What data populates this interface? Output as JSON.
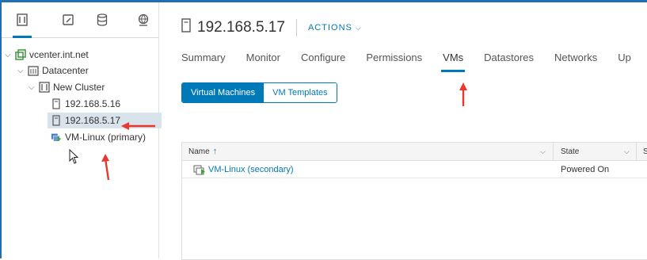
{
  "sidebar": {
    "tabs": [
      {
        "icon": "hosts-clusters-icon",
        "active": true
      },
      {
        "icon": "vms-templates-icon"
      },
      {
        "icon": "storage-icon"
      },
      {
        "icon": "networking-icon"
      }
    ],
    "tree": [
      {
        "label": "vcenter.int.net",
        "icon": "vcenter-icon"
      },
      {
        "label": "Datacenter",
        "icon": "datacenter-icon"
      },
      {
        "label": "New Cluster",
        "icon": "cluster-icon"
      },
      {
        "label": "192.168.5.16",
        "icon": "host-icon"
      },
      {
        "label": "192.168.5.17",
        "icon": "host-icon",
        "selected": true
      },
      {
        "label": "VM-Linux (primary)",
        "icon": "vm-icon"
      }
    ]
  },
  "header": {
    "title": "192.168.5.17",
    "actions_label": "ACTIONS"
  },
  "tabs": [
    "Summary",
    "Monitor",
    "Configure",
    "Permissions",
    "VMs",
    "Datastores",
    "Networks",
    "Up"
  ],
  "active_tab": "VMs",
  "toggle": {
    "virtual_machines": "Virtual Machines",
    "vm_templates": "VM Templates"
  },
  "grid": {
    "columns": {
      "name": "Name",
      "state": "State",
      "third": "S"
    },
    "rows": [
      {
        "name": "VM-Linux (secondary)",
        "state": "Powered On"
      }
    ]
  },
  "colors": {
    "accent": "#0079b8",
    "annotation": "#e8382f"
  }
}
